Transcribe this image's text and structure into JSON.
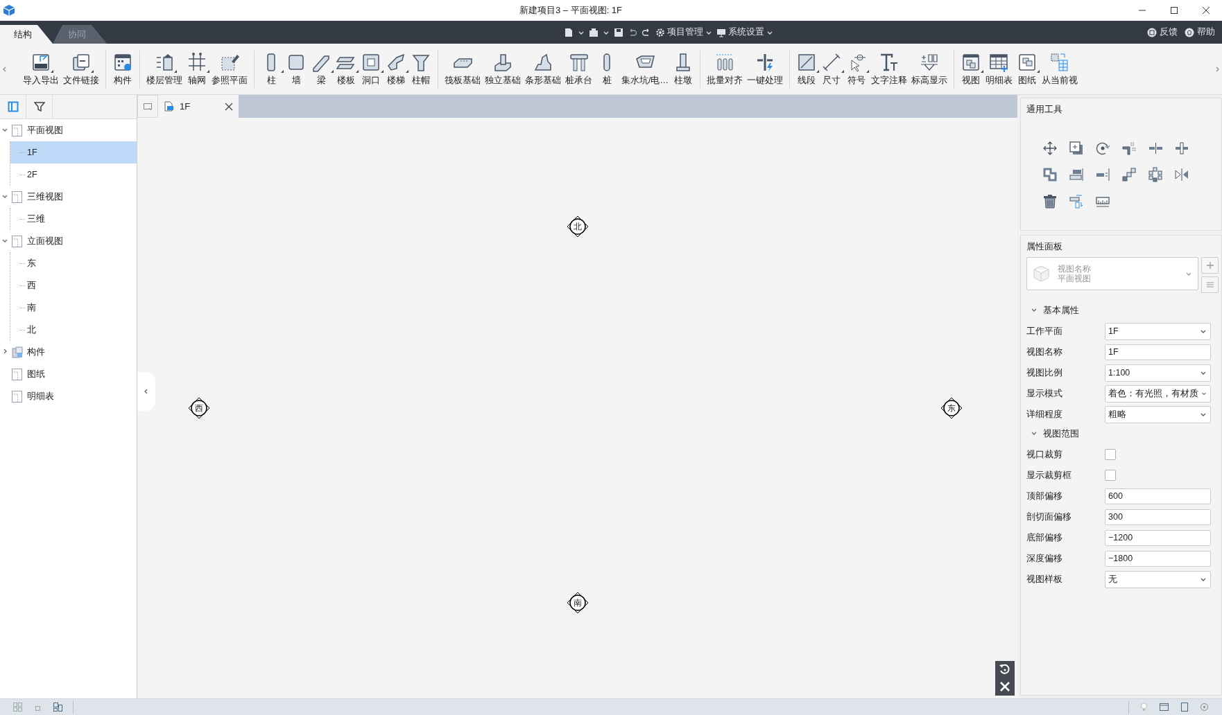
{
  "window": {
    "title": "新建项目3 – 平面视图: 1F"
  },
  "ribbon_tabs": [
    {
      "label": "结构",
      "selected": true
    },
    {
      "label": "协同",
      "selected": false
    }
  ],
  "quick_menus": [
    {
      "label": "项目管理"
    },
    {
      "label": "系统设置"
    }
  ],
  "help_links": [
    {
      "label": "反馈"
    },
    {
      "label": "帮助"
    }
  ],
  "toolbar": {
    "groups": [
      [
        {
          "label": "导入导出",
          "dropdown": true
        },
        {
          "label": "文件链接",
          "dropdown": true
        }
      ],
      [
        {
          "label": "构件",
          "dropdown": false
        }
      ],
      [
        {
          "label": "楼层管理",
          "dropdown": true
        },
        {
          "label": "轴网",
          "dropdown": true
        },
        {
          "label": "参照平面",
          "dropdown": false
        }
      ],
      [
        {
          "label": "柱",
          "dropdown": true
        },
        {
          "label": "墙",
          "dropdown": false
        },
        {
          "label": "梁",
          "dropdown": true
        },
        {
          "label": "楼板",
          "dropdown": true
        },
        {
          "label": "洞口",
          "dropdown": true
        },
        {
          "label": "楼梯",
          "dropdown": true
        },
        {
          "label": "柱帽",
          "dropdown": false
        }
      ],
      [
        {
          "label": "筏板基础",
          "dropdown": false
        },
        {
          "label": "独立基础",
          "dropdown": false
        },
        {
          "label": "条形基础",
          "dropdown": false
        },
        {
          "label": "桩承台",
          "dropdown": false
        },
        {
          "label": "桩",
          "dropdown": false
        },
        {
          "label": "集水坑/电…",
          "dropdown": false
        },
        {
          "label": "柱墩",
          "dropdown": false
        }
      ],
      [
        {
          "label": "批量对齐",
          "dropdown": false
        },
        {
          "label": "一键处理",
          "dropdown": false
        }
      ],
      [
        {
          "label": "线段",
          "dropdown": true
        },
        {
          "label": "尺寸",
          "dropdown": true
        },
        {
          "label": "符号",
          "dropdown": true
        },
        {
          "label": "文字注释",
          "dropdown": false
        },
        {
          "label": "标高显示",
          "dropdown": false
        }
      ],
      [
        {
          "label": "视图",
          "dropdown": true
        },
        {
          "label": "明细表",
          "dropdown": false
        },
        {
          "label": "图纸",
          "dropdown": true
        },
        {
          "label": "从当前视",
          "dropdown": false
        }
      ]
    ]
  },
  "sidebar": {
    "tree": [
      {
        "label": "平面视图",
        "kind": "view-group",
        "expanded": true,
        "selected": false,
        "children": [
          {
            "label": "1F",
            "selected": true
          },
          {
            "label": "2F",
            "selected": false
          }
        ]
      },
      {
        "label": "三维视图",
        "kind": "view-group",
        "expanded": true,
        "selected": false,
        "children": [
          {
            "label": "三维",
            "selected": false
          }
        ]
      },
      {
        "label": "立面视图",
        "kind": "view-group",
        "expanded": true,
        "selected": false,
        "children": [
          {
            "label": "东",
            "selected": false
          },
          {
            "label": "西",
            "selected": false
          },
          {
            "label": "南",
            "selected": false
          },
          {
            "label": "北",
            "selected": false
          }
        ]
      },
      {
        "label": "构件",
        "kind": "component-group",
        "expanded": false,
        "selected": false
      },
      {
        "label": "图纸",
        "kind": "view-group",
        "selected": false
      },
      {
        "label": "明细表",
        "kind": "view-group",
        "selected": false
      }
    ]
  },
  "document_tabs": [
    {
      "label": "1F",
      "selected": true
    }
  ],
  "view_markers": [
    {
      "label": "北"
    },
    {
      "label": "西"
    },
    {
      "label": "东"
    },
    {
      "label": "南"
    }
  ],
  "tools_panel": {
    "title": "通用工具"
  },
  "properties": {
    "title": "属性面板",
    "type_selector": {
      "name_label": "视图名称",
      "type": "平面视图"
    },
    "sections": [
      {
        "title": "基本属性",
        "expanded": true,
        "rows": [
          {
            "kind": "select",
            "label": "工作平面",
            "value": "1F"
          },
          {
            "kind": "text",
            "label": "视图名称",
            "value": "1F"
          },
          {
            "kind": "select",
            "label": "视图比例",
            "value": "1:100"
          },
          {
            "kind": "select",
            "label": "显示模式",
            "value": "着色：有光照，有材质"
          },
          {
            "kind": "select",
            "label": "详细程度",
            "value": "粗略"
          }
        ]
      },
      {
        "title": "视图范围",
        "expanded": true,
        "rows": [
          {
            "kind": "checkbox",
            "label": "视口裁剪",
            "checked": false
          },
          {
            "kind": "checkbox",
            "label": "显示裁剪框",
            "checked": false
          },
          {
            "kind": "text",
            "label": "顶部偏移",
            "value": "600"
          },
          {
            "kind": "text",
            "label": "剖切面偏移",
            "value": "300"
          },
          {
            "kind": "text",
            "label": "底部偏移",
            "value": "−1200"
          },
          {
            "kind": "text",
            "label": "深度偏移",
            "value": "−1800"
          },
          {
            "kind": "select",
            "label": "视图样板",
            "value": "无"
          }
        ]
      }
    ]
  }
}
